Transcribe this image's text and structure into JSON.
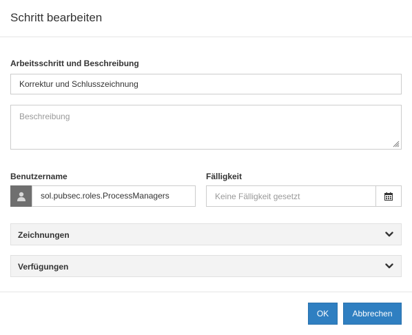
{
  "dialog": {
    "title": "Schritt bearbeiten"
  },
  "step": {
    "label": "Arbeitsschritt und Beschreibung",
    "name_value": "Korrektur und Schlusszeichnung",
    "description_placeholder": "Beschreibung"
  },
  "user": {
    "label": "Benutzername",
    "icon": "user-icon",
    "value": "sol.pubsec.roles.ProcessManagers"
  },
  "due": {
    "label": "Fälligkeit",
    "placeholder": "Keine Fälligkeit gesetzt",
    "icon": "calendar-icon"
  },
  "panels": [
    {
      "title": "Zeichnungen",
      "icon": "chevron-down-icon"
    },
    {
      "title": "Verfügungen",
      "icon": "chevron-down-icon"
    }
  ],
  "footer": {
    "ok_label": "OK",
    "cancel_label": "Abbrechen"
  },
  "colors": {
    "primary_button": "#2f7fc1",
    "addon_background": "#6f6f6f",
    "panel_background": "#f3f3f3",
    "placeholder_text": "#999999"
  }
}
